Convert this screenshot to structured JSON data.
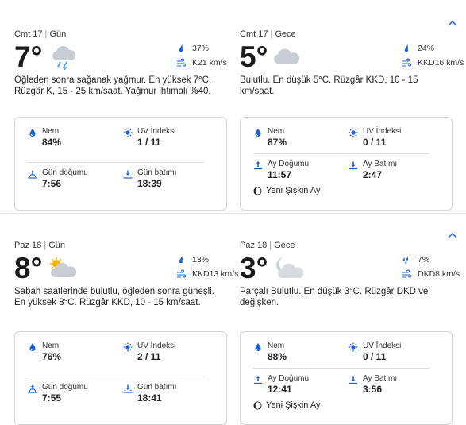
{
  "days": [
    {
      "day": {
        "date": "Cmt 17",
        "period": "Gün",
        "temp": "7°",
        "precip": "37%",
        "wind": "K21 km/s",
        "description": "Öğleden sonra sağanak yağmur. En yüksek 7°C. Rüzgâr K, 15 - 25 km/saat. Yağmur ihtimali %40.",
        "humidity_label": "Nem",
        "humidity": "84%",
        "uv_label": "UV İndeksi",
        "uv": "1 / 11",
        "rise_label": "Gün doğumu",
        "rise": "7:56",
        "set_label": "Gün batımı",
        "set": "18:39",
        "icon": "rain-cloud-icon"
      },
      "night": {
        "date": "Cmt 17",
        "period": "Gece",
        "temp": "5°",
        "precip": "24%",
        "wind": "KKD16 km/s",
        "description": "Bulutlu. En düşük 5°C. Rüzgâr KKD, 10 - 15 km/saat.",
        "humidity_label": "Nem",
        "humidity": "87%",
        "uv_label": "UV İndeksi",
        "uv": "0 / 11",
        "rise_label": "Ay Doğumu",
        "rise": "11:57",
        "set_label": "Ay Batımı",
        "set": "2:47",
        "moon_phase": "Yeni Şişkin Ay",
        "icon": "cloud-icon"
      }
    },
    {
      "day": {
        "date": "Paz 18",
        "period": "Gün",
        "temp": "8°",
        "precip": "13%",
        "wind": "KKD13 km/s",
        "description": "Sabah saatlerinde bulutlu, öğleden sonra güneşli. En yüksek 8°C. Rüzgâr KKD, 10 - 15 km/saat.",
        "humidity_label": "Nem",
        "humidity": "76%",
        "uv_label": "UV İndeksi",
        "uv": "2 / 11",
        "rise_label": "Gün doğumu",
        "rise": "7:55",
        "set_label": "Gün batımı",
        "set": "18:41",
        "icon": "partly-sunny-icon"
      },
      "night": {
        "date": "Paz 18",
        "period": "Gece",
        "temp": "3°",
        "precip": "7%",
        "wind": "DKD8 km/s",
        "description": "Parçalı Bulutlu. En düşük 3°C. Rüzgâr DKD ve değişken.",
        "humidity_label": "Nem",
        "humidity": "88%",
        "uv_label": "UV İndeksi",
        "uv": "0 / 11",
        "rise_label": "Ay Doğumu",
        "rise": "12:41",
        "set_label": "Ay Batımı",
        "set": "3:56",
        "moon_phase": "Yeni Şişkin Ay",
        "icon": "partly-cloudy-night-icon"
      }
    }
  ],
  "colors": {
    "accent": "#1a5fd6",
    "card_border": "#d6d6d6"
  }
}
